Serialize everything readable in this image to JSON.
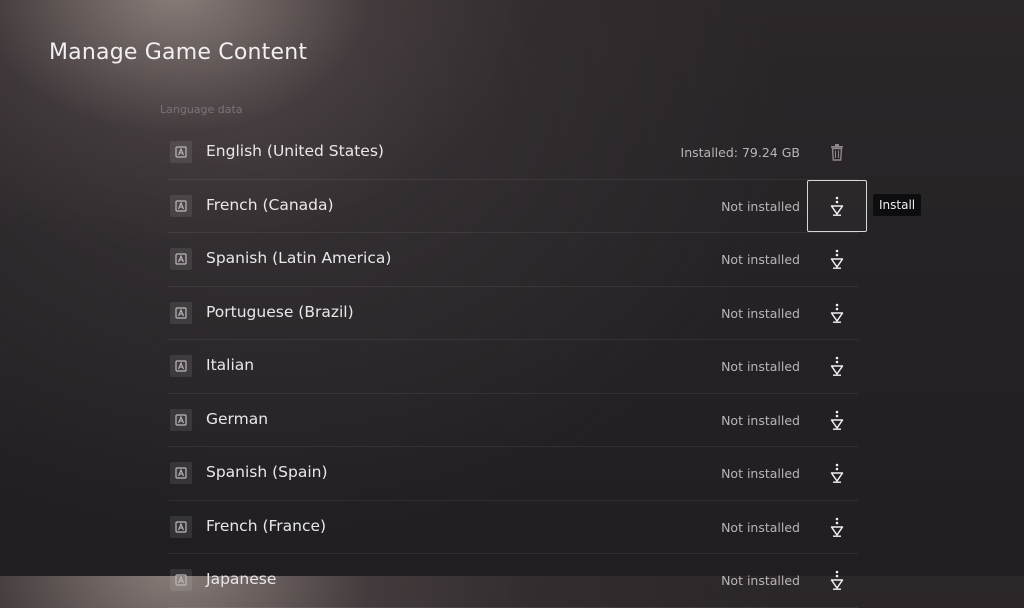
{
  "page": {
    "title": "Manage Game Content",
    "section_label": "Language data"
  },
  "tooltip": {
    "text": "Install"
  },
  "languages": [
    {
      "name": "English (United States)",
      "status": "Installed: 79.24 GB",
      "action_icon": "trash-icon"
    },
    {
      "name": "French (Canada)",
      "status": "Not installed",
      "action_icon": "download-icon"
    },
    {
      "name": "Spanish (Latin America)",
      "status": "Not installed",
      "action_icon": "download-icon"
    },
    {
      "name": "Portuguese (Brazil)",
      "status": "Not installed",
      "action_icon": "download-icon"
    },
    {
      "name": "Italian",
      "status": "Not installed",
      "action_icon": "download-icon"
    },
    {
      "name": "German",
      "status": "Not installed",
      "action_icon": "download-icon"
    },
    {
      "name": "Spanish (Spain)",
      "status": "Not installed",
      "action_icon": "download-icon"
    },
    {
      "name": "French (France)",
      "status": "Not installed",
      "action_icon": "download-icon"
    },
    {
      "name": "Japanese",
      "status": "Not installed",
      "action_icon": "download-icon"
    }
  ],
  "colors": {
    "focus_border": "#d9d6d8",
    "tooltip_bg": "#0d0c0e"
  }
}
